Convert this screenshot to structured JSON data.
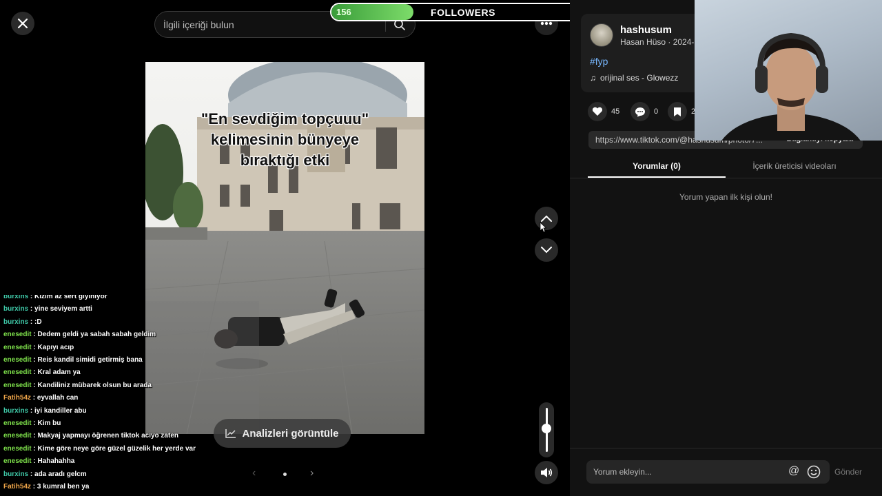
{
  "top": {
    "search_placeholder": "İlgili içeriği bulun",
    "close_icon": "close-icon",
    "more_icon": "more-horizontal-icon"
  },
  "post": {
    "caption_lines": [
      "\"En sevdiğim topçuuu\"",
      "kelimesinin bünyeye",
      "bıraktığı etki"
    ],
    "analytics_label": "Analizleri görüntüle",
    "carousel_index": 1,
    "carousel_total": 1
  },
  "followers_goal": {
    "current": "156",
    "label": "FOLLOWERS",
    "goal": "500",
    "progress_fraction": 0.312
  },
  "chat": {
    "colors": {
      "burxins": "#3fc9a8",
      "enesedit": "#7ee04b",
      "Fatih54z": "#f0a64a"
    },
    "messages": [
      {
        "user": "burxins",
        "text": "Kızım az sert giyiniyor"
      },
      {
        "user": "burxins",
        "text": "yine seviyem artti"
      },
      {
        "user": "burxins",
        "text": ":D"
      },
      {
        "user": "enesedit",
        "text": "Dedem geldi ya sabah sabah geldim"
      },
      {
        "user": "enesedit",
        "text": "Kapıyı acıp"
      },
      {
        "user": "enesedit",
        "text": "Reis kandil simidi getirmiş bana"
      },
      {
        "user": "enesedit",
        "text": "Kral adam ya"
      },
      {
        "user": "enesedit",
        "text": "Kandiliniz mübarek olsun bu arada"
      },
      {
        "user": "Fatih54z",
        "text": "eyvallah can"
      },
      {
        "user": "burxins",
        "text": "iyi kandiller abu"
      },
      {
        "user": "enesedit",
        "text": "Kim bu"
      },
      {
        "user": "enesedit",
        "text": "Makyaj yapmayı öğrenen tiktok acıyo zaten"
      },
      {
        "user": "enesedit",
        "text": "Kime göre neye göre güzel güzelik her yerde var"
      },
      {
        "user": "enesedit",
        "text": "Hahahahha"
      },
      {
        "user": "burxins",
        "text": "ada aradı gelcm"
      },
      {
        "user": "Fatih54z",
        "text": "3 kumral ben ya"
      }
    ]
  },
  "author": {
    "username": "hashusum",
    "subline": "Hasan Hüso · 2024-",
    "hashtag": "#fyp",
    "sound": "orijinal ses - Glowezz"
  },
  "stats": {
    "likes": "45",
    "comments": "0",
    "saves": "2"
  },
  "link": {
    "url": "https://www.tiktok.com/@hashusum/photo/7...",
    "copy_label": "Bağlantıyı kopyala"
  },
  "tabs": {
    "comments": "Yorumlar (0)",
    "creator_videos": "İçerik üreticisi videoları"
  },
  "comments": {
    "empty": "Yorum yapan ilk kişi olun!",
    "input_placeholder": "Yorum ekleyin...",
    "send": "Gönder"
  }
}
